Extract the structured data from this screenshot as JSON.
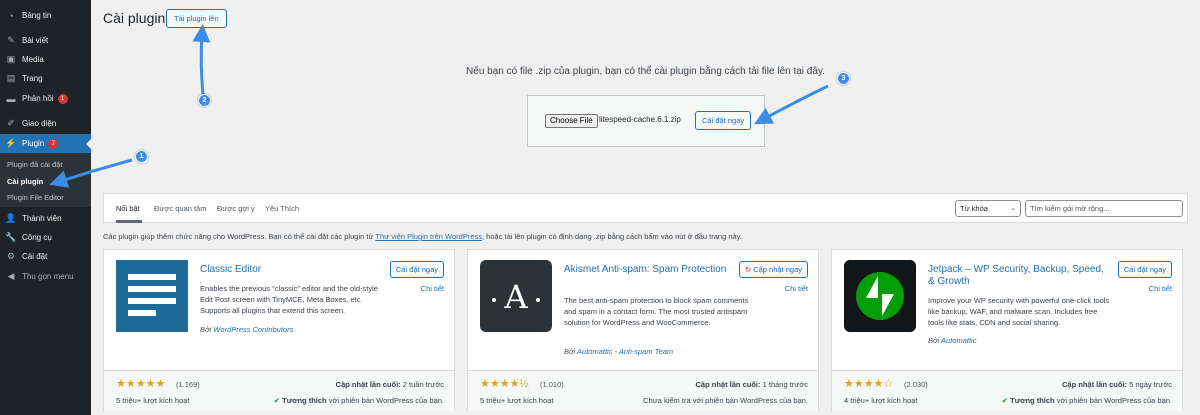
{
  "sidebar": {
    "items": [
      {
        "label": "Bảng tin",
        "icon": "dashboard-icon"
      },
      {
        "label": "Bài viết",
        "icon": "pin-icon"
      },
      {
        "label": "Media",
        "icon": "media-icon"
      },
      {
        "label": "Trang",
        "icon": "page-icon"
      },
      {
        "label": "Phản hồi",
        "icon": "comment-icon",
        "badge": "1"
      },
      {
        "label": "Giao diện",
        "icon": "brush-icon"
      },
      {
        "label": "Plugin",
        "icon": "plugin-icon",
        "badge": "7"
      },
      {
        "label": "Thành viên",
        "icon": "users-icon"
      },
      {
        "label": "Công cụ",
        "icon": "wrench-icon"
      },
      {
        "label": "Cài đặt",
        "icon": "settings-icon"
      },
      {
        "label": "Thu gọn menu",
        "icon": "collapse-icon"
      }
    ],
    "submenu": [
      "Plugin đã cài đặt",
      "Cài plugin",
      "Plugin File Editor"
    ]
  },
  "header": {
    "title": "Cài plugin",
    "upload_button": "Tải plugin lên"
  },
  "upload": {
    "message": "Nếu bạn có file .zip của plugin, bạn có thể cài plugin bằng cách tải file lên tại đây.",
    "choose_file": "Choose File",
    "file_name": "litespeed-cache.6.1.zip",
    "install_now": "Cài đặt ngay"
  },
  "filter": {
    "tabs": [
      "Nổi bật",
      "Được quan tâm",
      "Được gợi ý",
      "Yêu Thích"
    ],
    "search_type": "Từ khóa",
    "search_placeholder": "Tìm kiếm gói mở rộng..."
  },
  "description": {
    "before": "Các plugin giúp thêm chức năng cho WordPress. Bạn có thể cài đặt các plugin từ ",
    "link": "Thư viện Plugin trên WordPress",
    "after": ", hoặc tải lên plugin có định dạng .zip bằng cách bấm vào nút ở đầu trang này."
  },
  "cards": [
    {
      "name": "Classic Editor",
      "action": "Cài đặt ngay",
      "details": "Chi tiết",
      "description": "Enables the previous \"classic\" editor and the old-style Edit Post screen with TinyMCE, Meta Boxes, etc. Supports all plugins that extend this screen.",
      "author_prefix": "Bởi",
      "author": "WordPress Contributors",
      "rating_count": "(1.169)",
      "updated_label": "Cập nhật lần cuối:",
      "updated": "2 tuần trước",
      "installs": "5 triệu+ lượt kích hoạt",
      "compat_label": "Tương thích",
      "compat_text": "với phiên bản WordPress của bạn.",
      "stars": "★★★★★"
    },
    {
      "name": "Akismet Anti-spam: Spam Protection",
      "action": "Cập nhật ngay",
      "details": "Chi tiết",
      "description": "The best anti-spam protection to block spam comments and spam in a contact form. The most trusted antispam solution for WordPress and WooCommerce.",
      "author_prefix": "Bởi",
      "author": "Automattic - Anti-spam Team",
      "rating_count": "(1.010)",
      "updated_label": "Cập nhật lần cuối:",
      "updated": "1 tháng trước",
      "installs": "5 triệu+ lượt kích hoạt",
      "compat_label": "",
      "compat_text": "Chưa kiểm tra với phiên bản WordPress của bạn.",
      "stars": "★★★★½"
    },
    {
      "name": "Jetpack – WP Security, Backup, Speed, & Growth",
      "action": "Cài đặt ngay",
      "details": "Chi tiết",
      "description": "Improve your WP security with powerful one-click tools like backup, WAF, and malware scan. Includes free tools like stats, CDN and social sharing.",
      "author_prefix": "Bởi",
      "author": "Automattic",
      "rating_count": "(2.030)",
      "updated_label": "Cập nhật lần cuối:",
      "updated": "5 ngày trước",
      "installs": "4 triệu+ lượt kích hoạt",
      "compat_label": "Tương thích",
      "compat_text": "với phiên bản WordPress của bạn.",
      "stars": "★★★★☆"
    }
  ],
  "annotations": [
    "1",
    "2",
    "3"
  ],
  "colors": {
    "accent": "#2271b1",
    "sidebar_bg": "#1d2327",
    "badge": "#d63638",
    "star": "#dba617",
    "annotation": "#3b8de8"
  }
}
